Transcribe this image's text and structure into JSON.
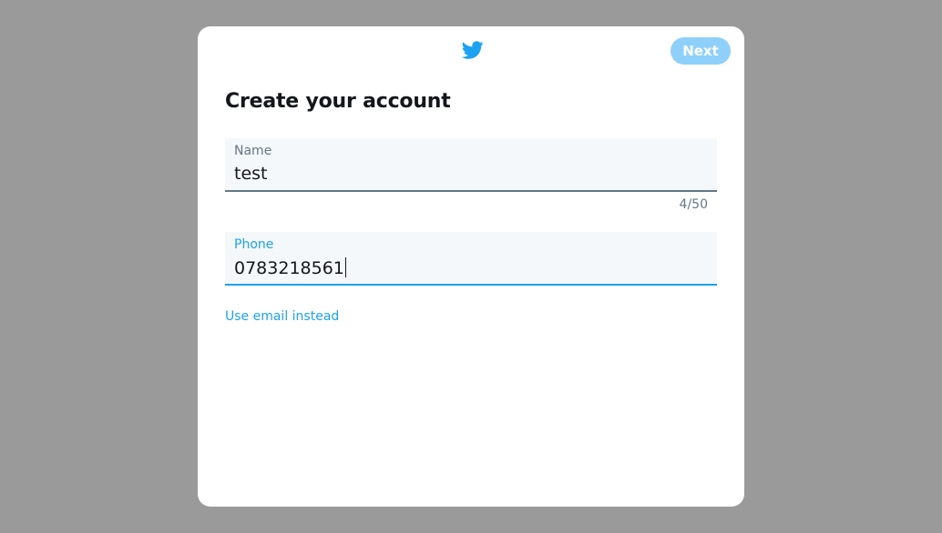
{
  "header": {
    "logo_icon": "twitter-bird-icon",
    "next_label": "Next",
    "brand_color": "#1da1f2",
    "next_disabled_color": "#8ed0f9"
  },
  "form": {
    "title": "Create your account",
    "name": {
      "label": "Name",
      "value": "test",
      "counter": "4/50"
    },
    "phone": {
      "label": "Phone",
      "value": "0783218561"
    },
    "alt_link": "Use email instead"
  }
}
